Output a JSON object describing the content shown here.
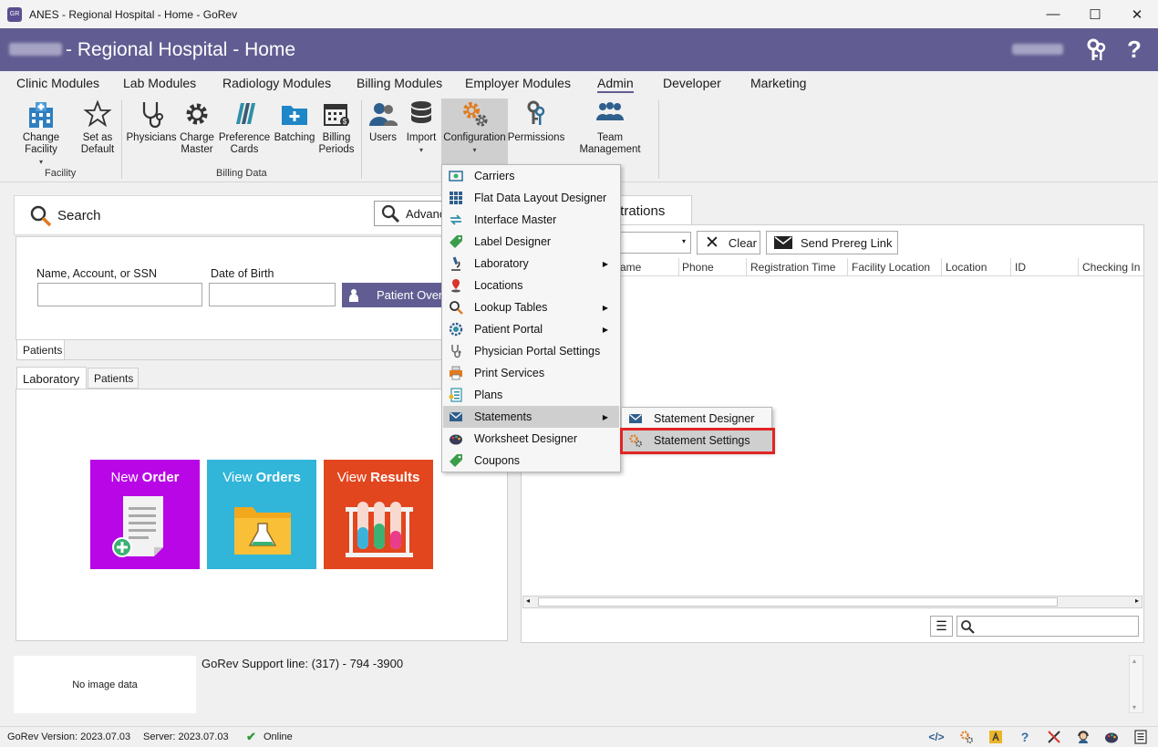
{
  "window": {
    "title": "ANES - Regional Hospital - Home - GoRev",
    "app_icon_text": "GoRev",
    "minimize": "—",
    "maximize": "☐",
    "close": "✕"
  },
  "header": {
    "title": "- Regional Hospital - Home",
    "help": "?"
  },
  "menu_tabs": [
    "Clinic Modules",
    "Lab Modules",
    "Radiology Modules",
    "Billing Modules",
    "Employer Modules",
    "Admin",
    "Developer",
    "Marketing"
  ],
  "active_tab": "Admin",
  "ribbon": {
    "facility": {
      "change_facility": "Change Facility",
      "set_default_1": "Set as",
      "set_default_2": "Default",
      "group": "Facility"
    },
    "billing_data": {
      "physicians": "Physicians",
      "charge_master_1": "Charge",
      "charge_master_2": "Master",
      "preference_cards_1": "Preference",
      "preference_cards_2": "Cards",
      "batching": "Batching",
      "billing_periods_1": "Billing",
      "billing_periods_2": "Periods",
      "group": "Billing Data"
    },
    "users": "Users",
    "import": "Import",
    "configuration": "Configuration",
    "permissions": "Permissions",
    "team_management": "Team Management"
  },
  "search": {
    "label": "Search",
    "advanced_button": "Advanc",
    "name_label": "Name, Account, or SSN",
    "dob_label": "Date of Birth",
    "patient_overview_button": "Patient Over",
    "patients_tab": "Patients"
  },
  "lower_tabs": {
    "laboratory": "Laboratory",
    "patients": "Patients"
  },
  "tiles": {
    "new_order": {
      "pre": "New ",
      "bold": "Order"
    },
    "view_orders": {
      "pre": "View ",
      "bold": "Orders"
    },
    "view_results": {
      "pre": "View ",
      "bold": "Results"
    }
  },
  "registrations": {
    "tab_label": "gistrations",
    "clear_button": "Clear",
    "send_prereg_button": "Send Prereg Link",
    "columns": [
      "ame",
      "Phone",
      "Registration Time",
      "Facility Location",
      "Location",
      "ID",
      "Checking In"
    ]
  },
  "config_menu": {
    "items": [
      {
        "label": "Carriers",
        "submenu": false
      },
      {
        "label": "Flat Data Layout Designer",
        "submenu": false
      },
      {
        "label": "Interface Master",
        "submenu": false
      },
      {
        "label": "Label Designer",
        "submenu": false
      },
      {
        "label": "Laboratory",
        "submenu": true
      },
      {
        "label": "Locations",
        "submenu": false
      },
      {
        "label": "Lookup Tables",
        "submenu": true
      },
      {
        "label": "Patient Portal",
        "submenu": true
      },
      {
        "label": "Physician Portal Settings",
        "submenu": false
      },
      {
        "label": "Print Services",
        "submenu": false
      },
      {
        "label": "Plans",
        "submenu": false
      },
      {
        "label": "Statements",
        "submenu": true
      },
      {
        "label": "Worksheet Designer",
        "submenu": false
      },
      {
        "label": "Coupons",
        "submenu": false
      }
    ],
    "highlighted": "Statements"
  },
  "statements_submenu": {
    "items": [
      "Statement Designer",
      "Statement Settings"
    ],
    "highlighted": "Statement Settings"
  },
  "footer": {
    "no_image": "No image data",
    "support_line": "GoRev Support line: (317) - 794 -3900"
  },
  "statusbar": {
    "version": "GoRev Version: 2023.07.03",
    "server": "Server: 2023.07.03",
    "status": "Online"
  },
  "colors": {
    "accent": "#615d92",
    "new_order_tile": "#b806e6",
    "view_orders_tile": "#31b5d9",
    "view_results_tile": "#e2461f",
    "highlight_box": "#e02424"
  }
}
